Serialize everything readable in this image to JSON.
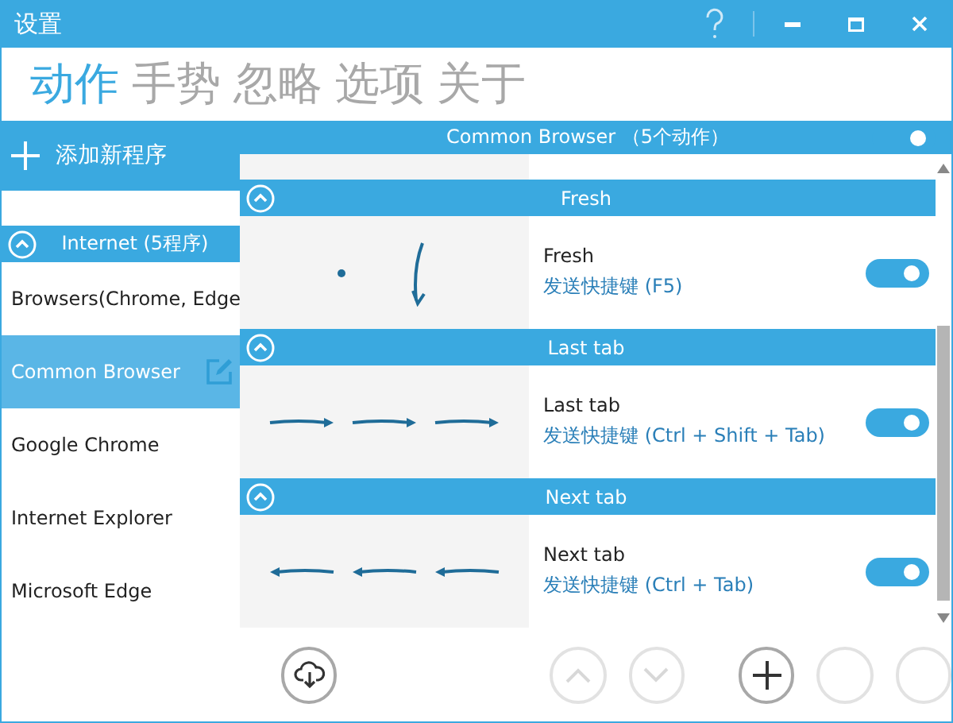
{
  "window": {
    "title": "设置"
  },
  "tabs": [
    {
      "label": "动作",
      "selected": true
    },
    {
      "label": "手势",
      "selected": false
    },
    {
      "label": "忽略",
      "selected": false
    },
    {
      "label": "选项",
      "selected": false
    },
    {
      "label": "关于",
      "selected": false
    }
  ],
  "sidebar": {
    "add_button": "添加新程序",
    "group": {
      "label": "Internet (5程序)",
      "expanded": true
    },
    "items": [
      {
        "label": "Browsers(Chrome, Edge",
        "selected": false
      },
      {
        "label": "Common Browser",
        "selected": true
      },
      {
        "label": "Google Chrome",
        "selected": false
      },
      {
        "label": "Internet Explorer",
        "selected": false
      },
      {
        "label": "Microsoft Edge",
        "selected": false
      }
    ]
  },
  "panel": {
    "title": "Common Browser",
    "count": "（5个动作）",
    "on": true,
    "actions": [
      {
        "section": "Fresh",
        "expanded": true,
        "name": "Fresh",
        "shortcut": "发送快捷键 (F5)",
        "on": true,
        "kind": "dot-down"
      },
      {
        "section": "Last tab",
        "expanded": true,
        "name": "Last tab",
        "shortcut": "发送快捷键 (Ctrl + Shift + Tab)",
        "on": true,
        "kind": "right"
      },
      {
        "section": "Next tab",
        "expanded": true,
        "name": "Next tab",
        "shortcut": "发送快捷键 (Ctrl + Tab)",
        "on": true,
        "kind": "left"
      }
    ]
  },
  "toolbar": [
    {
      "kind": "cloud",
      "disabled": false
    },
    {
      "kind": "up",
      "disabled": true
    },
    {
      "kind": "down",
      "disabled": true
    },
    {
      "kind": "add",
      "disabled": false
    },
    {
      "kind": "empty",
      "disabled": true
    },
    {
      "kind": "empty",
      "disabled": true
    }
  ]
}
